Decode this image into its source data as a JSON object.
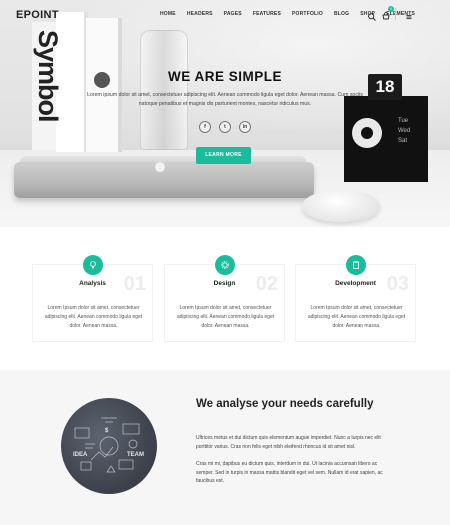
{
  "nav": {
    "logo": "EPOINT",
    "items": [
      "HOME",
      "HEADERS",
      "PAGES",
      "FEATURES",
      "PORTFOLIO",
      "BLOG",
      "SHOP",
      "ELEMENTS"
    ],
    "cart_count": "0"
  },
  "hero": {
    "book_text": "Symbol",
    "calendar_number": "18",
    "title": "WE ARE SIMPLE",
    "subtitle": "Lorem ipsum dolor sit amet, consectetuer adipiscing elit. Aenean commodo ligula eget dolor. Aenean massa. Cum sociis natoque penatibus et magnis dis parturient montes, nascetur ridiculus mus.",
    "socials": [
      "f",
      "t",
      "in"
    ],
    "button": "LEARN MORE"
  },
  "services": [
    {
      "number": "01",
      "title": "Analysis",
      "text": "Lorem Ipsum dolor sit amet, consectetuer adipiscing elit. Aenean commodo ligula eget dolor. Aenean massa.",
      "icon": "lightbulb-icon"
    },
    {
      "number": "02",
      "title": "Design",
      "text": "Lorem Ipsum dolor sit amet, consectetuer adipiscing elit. Aenean commodo ligula eget dolor. Aenean massa.",
      "icon": "gear-icon"
    },
    {
      "number": "03",
      "title": "Development",
      "text": "Lorem Ipsum dolor sit amet, consectetuer adipiscing elit. Aenean commodo ligula eget dolor. Aenean massa.",
      "icon": "clipboard-icon"
    }
  ],
  "analyse": {
    "title": "We analyse your needs carefully",
    "p1": "Ultrices metus et dui dictum quis elementum augue imperdiet. Nunc a turpis nec elit porttitor varius. Cras non felis eget nibh eleifend rhoncus id sit amet nisl.",
    "p2": "Cras mi mi, dapibus eu dictum quis, interdum in dui. Ut lacinia accumsan libero ac semper. Sed in turpis in massa mattis blandit eget vel sem. Nullam id erat sapien, ac faucibus est.",
    "image_labels": [
      "IDEA",
      "TEAM",
      "$"
    ]
  },
  "colors": {
    "accent": "#1bbc9b",
    "dark": "#222222",
    "grey_bg": "#f6f6f6"
  }
}
